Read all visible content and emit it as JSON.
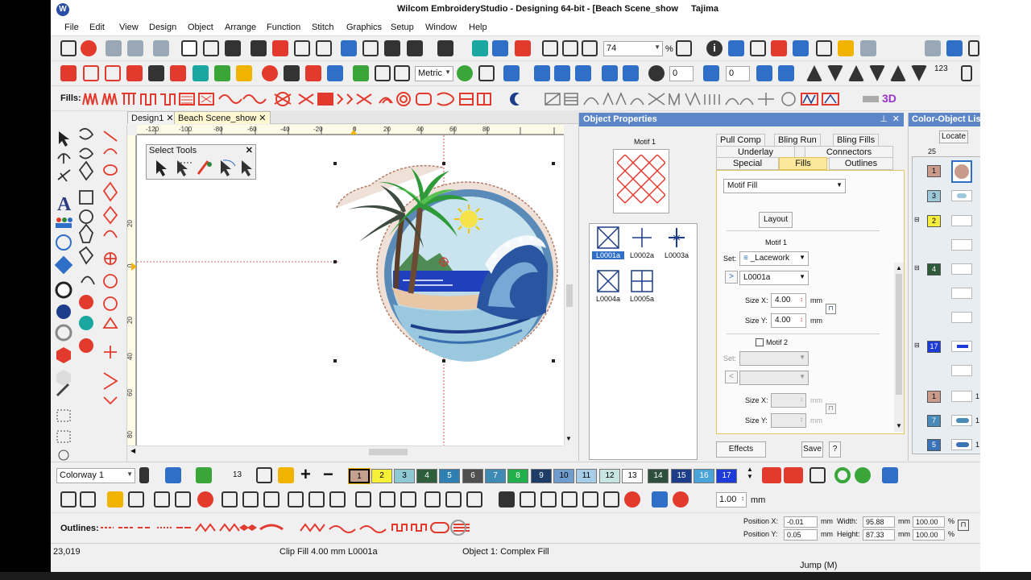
{
  "window": {
    "title": "Wilcom EmbroideryStudio - Designing 64-bit - [Beach Scene_show",
    "machine": "Tajima",
    "logo_glyph": "W"
  },
  "menu": [
    "File",
    "Edit",
    "View",
    "Design",
    "Object",
    "Arrange",
    "Function",
    "Stitch",
    "Graphics",
    "Setup",
    "Window",
    "Help"
  ],
  "toolbar1": {
    "zoom_value": "74",
    "zoom_unit": "%",
    "letters": [
      "i"
    ]
  },
  "toolbar2": {
    "units_value": "Metric",
    "rotation_value": "0",
    "angle_value": "0",
    "badge": "123"
  },
  "fills_bar": {
    "label": "Fills:",
    "threed_label": "3D"
  },
  "document_tabs": [
    "Design1",
    "Beach Scene_show"
  ],
  "ruler_top": [
    "-120",
    "-100",
    "-80",
    "-60",
    "-40",
    "-20",
    "0",
    "20",
    "40",
    "60",
    "80"
  ],
  "ruler_left": [
    "20",
    "0",
    "20",
    "40",
    "60",
    "80"
  ],
  "select_tools": {
    "title": "Select Tools"
  },
  "left_tools": {
    "text_glyph": "A"
  },
  "object_properties": {
    "title": "Object Properties",
    "tabs_row1": [
      "Pull Comp",
      "Bling Run",
      "Bling Fills"
    ],
    "tabs_row2": [
      "Underlay",
      "Connectors"
    ],
    "tabs_row3": [
      "Special",
      "Fills",
      "Outlines"
    ],
    "fill_type": "Motif Fill",
    "layout_button": "Layout",
    "motif1_label": "Motif 1",
    "motif1_caption": "Motif 1",
    "set_label": "Set:",
    "set_value": "_Lacework",
    "motif_value": "L0001a",
    "size_x_label": "Size X:",
    "size_x_value": "4.00",
    "size_y_label": "Size Y:",
    "size_y_value": "4.00",
    "unit": "mm",
    "motif2_label": "Motif 2",
    "motif_list": [
      "L0001a",
      "L0002a",
      "L0003a",
      "L0004a",
      "L0005a"
    ],
    "effects_button": "Effects",
    "save_button": "Save",
    "help_button": "?",
    "arrow_button": ">",
    "arrow_button_disabled": "<"
  },
  "color_object_list": {
    "title": "Color-Object List",
    "locate_button": "Locate",
    "count": "25",
    "entries": [
      {
        "num": "1",
        "color": "#c99b8b"
      },
      {
        "num": "3",
        "color": "#9cc8d8"
      },
      {
        "num": "2",
        "color": "#f6ee3a"
      },
      {
        "num": "4",
        "color": "#2e5a3a"
      },
      {
        "num": "17",
        "color": "#1d3bd8"
      },
      {
        "num": "1",
        "color": "#c99b8b"
      },
      {
        "num": "7",
        "color": "#4a8ab8"
      },
      {
        "num": "5",
        "color": "#3a72b8"
      }
    ],
    "trailing": [
      "1",
      "1",
      "1"
    ]
  },
  "colorway": {
    "name": "Colorway 1",
    "current": "13",
    "swatches": [
      {
        "num": "1",
        "color": "#c4a08e",
        "text": "#000"
      },
      {
        "num": "2",
        "color": "#f7f038",
        "text": "#000"
      },
      {
        "num": "3",
        "color": "#8ec9d3",
        "text": "#000"
      },
      {
        "num": "4",
        "color": "#2f5e3d",
        "text": "#fff"
      },
      {
        "num": "5",
        "color": "#2e7fb2",
        "text": "#fff"
      },
      {
        "num": "6",
        "color": "#4f4f4f",
        "text": "#fff"
      },
      {
        "num": "7",
        "color": "#3f8ab5",
        "text": "#fff"
      },
      {
        "num": "8",
        "color": "#21b04c",
        "text": "#fff"
      },
      {
        "num": "9",
        "color": "#1d3d66",
        "text": "#fff"
      },
      {
        "num": "10",
        "color": "#6e9ccc",
        "text": "#000"
      },
      {
        "num": "11",
        "color": "#a8cde8",
        "text": "#000"
      },
      {
        "num": "12",
        "color": "#c7e6e3",
        "text": "#000"
      },
      {
        "num": "13",
        "color": "#ffffff",
        "text": "#000"
      },
      {
        "num": "14",
        "color": "#2d4f3b",
        "text": "#fff"
      },
      {
        "num": "15",
        "color": "#1d3c8a",
        "text": "#fff"
      },
      {
        "num": "16",
        "color": "#4aa3d9",
        "text": "#fff"
      },
      {
        "num": "17",
        "color": "#1d3bd8",
        "text": "#fff"
      }
    ]
  },
  "row2": {
    "scale_value": "1.00",
    "scale_unit": "mm"
  },
  "outlines_bar": {
    "label": "Outlines:"
  },
  "position": {
    "pos_x_label": "Position X:",
    "pos_x": "-0.01",
    "pos_y_label": "Position Y:",
    "pos_y": "0.05",
    "width_label": "Width:",
    "width": "95.88",
    "height_label": "Height:",
    "height": "87.33",
    "pct_w": "100.00",
    "pct_h": "100.00",
    "unit": "mm",
    "pct": "%"
  },
  "status": {
    "coords": "23,019",
    "fill_info": "Clip Fill  4.00 mm L0001a",
    "object_info": "Object 1: Complex Fill",
    "jump": "Jump (M)"
  }
}
